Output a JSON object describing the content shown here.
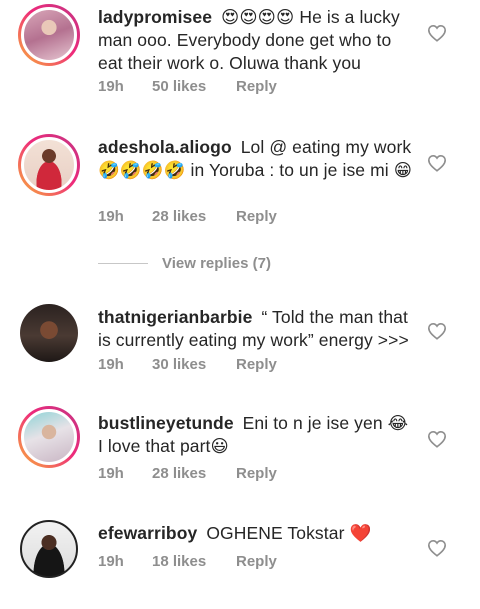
{
  "comments": [
    {
      "username": "ladypromisee",
      "text": "😍😍😍😍 He is a lucky man ooo. Everybody done get who to eat their work o. Oluwa thank you",
      "time": "19h",
      "likes": "50 likes",
      "reply": "Reply",
      "story_ring": true
    },
    {
      "username": "adeshola.aliogo",
      "text": "Lol @ eating my work 🤣🤣🤣🤣 in Yoruba : to un je ise mi 😁",
      "time": "19h",
      "likes": "28 likes",
      "reply": "Reply",
      "story_ring": true
    },
    {
      "username": "thatnigerianbarbie",
      "text": "“ Told the man that is currently eating my work” energy >>>",
      "time": "19h",
      "likes": "30 likes",
      "reply": "Reply",
      "story_ring": false
    },
    {
      "username": "bustlineyetunde",
      "text": "Eni to n je ise yen 😂 I love that part😃",
      "time": "19h",
      "likes": "28 likes",
      "reply": "Reply",
      "story_ring": true
    },
    {
      "username": "efewarriboy",
      "text": "OGHENE Tokstar ❤️",
      "time": "19h",
      "likes": "18 likes",
      "reply": "Reply",
      "story_ring": false
    }
  ],
  "view_replies": "View replies (7)",
  "colors": {
    "text": "#262626",
    "meta": "#8e8e8e",
    "story_ring_start": "#f9b13a",
    "story_ring_end": "#c13584"
  },
  "icons": {
    "like": "heart-outline-icon"
  }
}
